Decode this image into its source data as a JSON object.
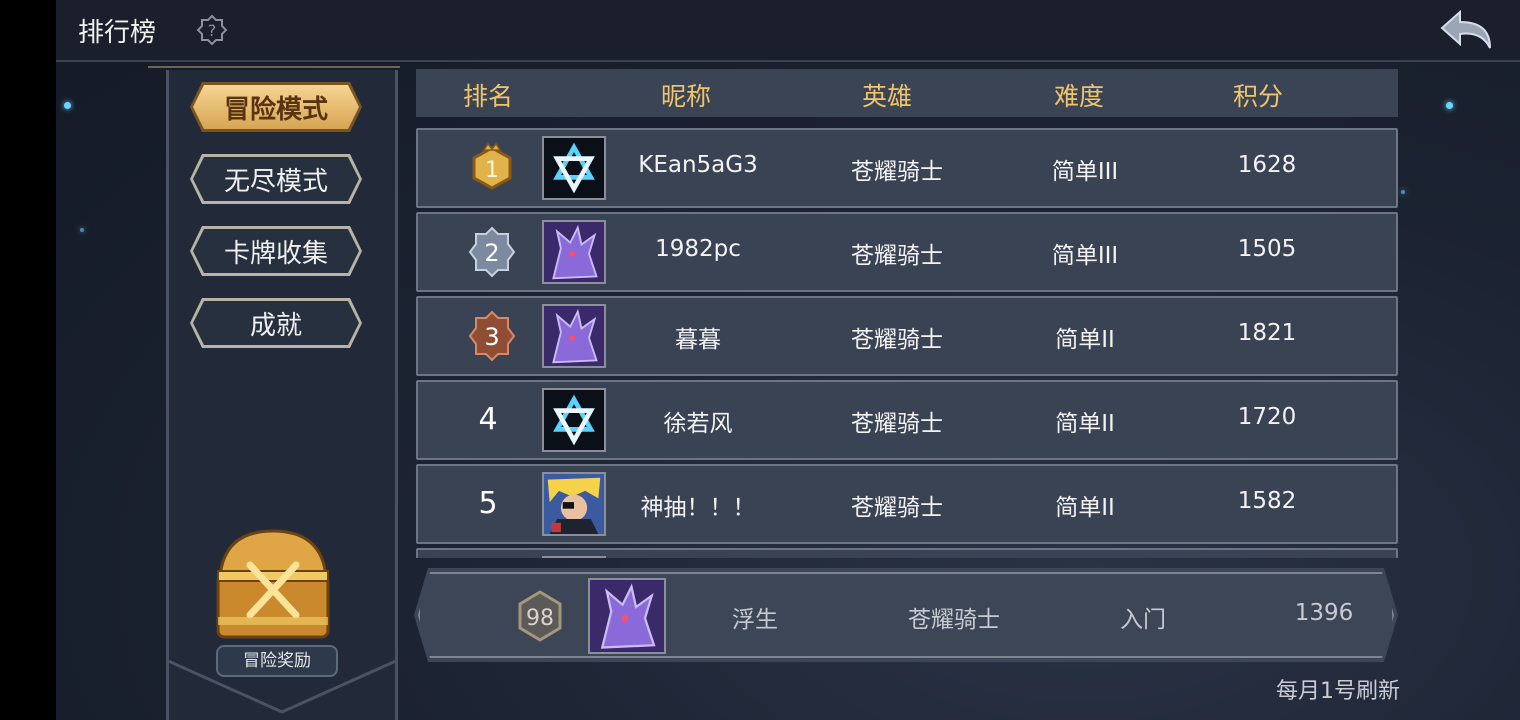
{
  "header": {
    "title": "排行榜",
    "help_icon": "help-question-icon",
    "back_icon": "back-arrow-icon"
  },
  "sidebar": {
    "modes": [
      {
        "label": "冒险模式",
        "active": true
      },
      {
        "label": "无尽模式",
        "active": false
      },
      {
        "label": "卡牌收集",
        "active": false
      },
      {
        "label": "成就",
        "active": false
      }
    ],
    "reward_label": "冒险奖励"
  },
  "table": {
    "columns": [
      "排名",
      "昵称",
      "英雄",
      "难度",
      "积分"
    ],
    "rows": [
      {
        "rank": "1",
        "avatar": "star-emblem",
        "name": "KEan5aG3",
        "hero": "苍耀骑士",
        "difficulty": "简单III",
        "score": "1628"
      },
      {
        "rank": "2",
        "avatar": "purple-dragon",
        "name": "1982pc",
        "hero": "苍耀骑士",
        "difficulty": "简单III",
        "score": "1505"
      },
      {
        "rank": "3",
        "avatar": "purple-dragon",
        "name": "暮暮",
        "hero": "苍耀骑士",
        "difficulty": "简单II",
        "score": "1821"
      },
      {
        "rank": "4",
        "avatar": "star-emblem",
        "name": "徐若风",
        "hero": "苍耀骑士",
        "difficulty": "简单II",
        "score": "1720"
      },
      {
        "rank": "5",
        "avatar": "blonde-pirate",
        "name": "神抽！！！",
        "hero": "苍耀骑士",
        "difficulty": "简单II",
        "score": "1582"
      }
    ],
    "my_row": {
      "rank": "98",
      "avatar": "purple-dragon",
      "name": "浮生",
      "hero": "苍耀骑士",
      "difficulty": "入门",
      "score": "1396"
    }
  },
  "footer": {
    "refresh_note": "每月1号刷新"
  },
  "colors": {
    "gold": "#f0c56a",
    "row_bg": "#3a4353",
    "active_btn": "#f6d591"
  }
}
